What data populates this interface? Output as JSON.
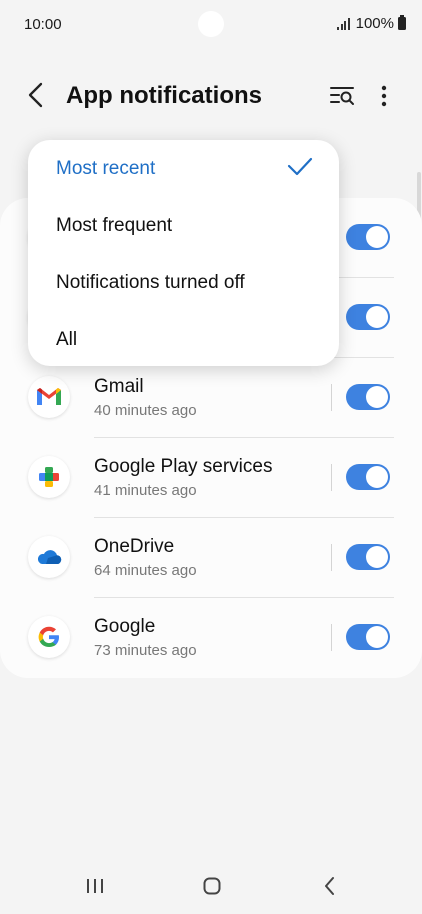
{
  "status_bar": {
    "time": "10:00",
    "battery": "100%"
  },
  "header": {
    "title": "App notifications"
  },
  "dropdown": {
    "options": [
      {
        "label": "Most recent",
        "selected": true
      },
      {
        "label": "Most frequent",
        "selected": false
      },
      {
        "label": "Notifications turned off",
        "selected": false
      },
      {
        "label": "All",
        "selected": false
      }
    ]
  },
  "apps": [
    {
      "name": "",
      "time": "",
      "icon": "hidden-app-icon",
      "enabled": true
    },
    {
      "name": "",
      "time": "",
      "icon": "hidden-app-icon",
      "enabled": true
    },
    {
      "name": "Gmail",
      "time": "40 minutes ago",
      "icon": "gmail-icon",
      "enabled": true
    },
    {
      "name": "Google Play services",
      "time": "41 minutes ago",
      "icon": "google-play-services-icon",
      "enabled": true
    },
    {
      "name": "OneDrive",
      "time": "64 minutes ago",
      "icon": "onedrive-icon",
      "enabled": true
    },
    {
      "name": "Google",
      "time": "73 minutes ago",
      "icon": "google-icon",
      "enabled": true
    }
  ],
  "colors": {
    "accent": "#3e82e0",
    "selected_text": "#1f6fc6"
  }
}
